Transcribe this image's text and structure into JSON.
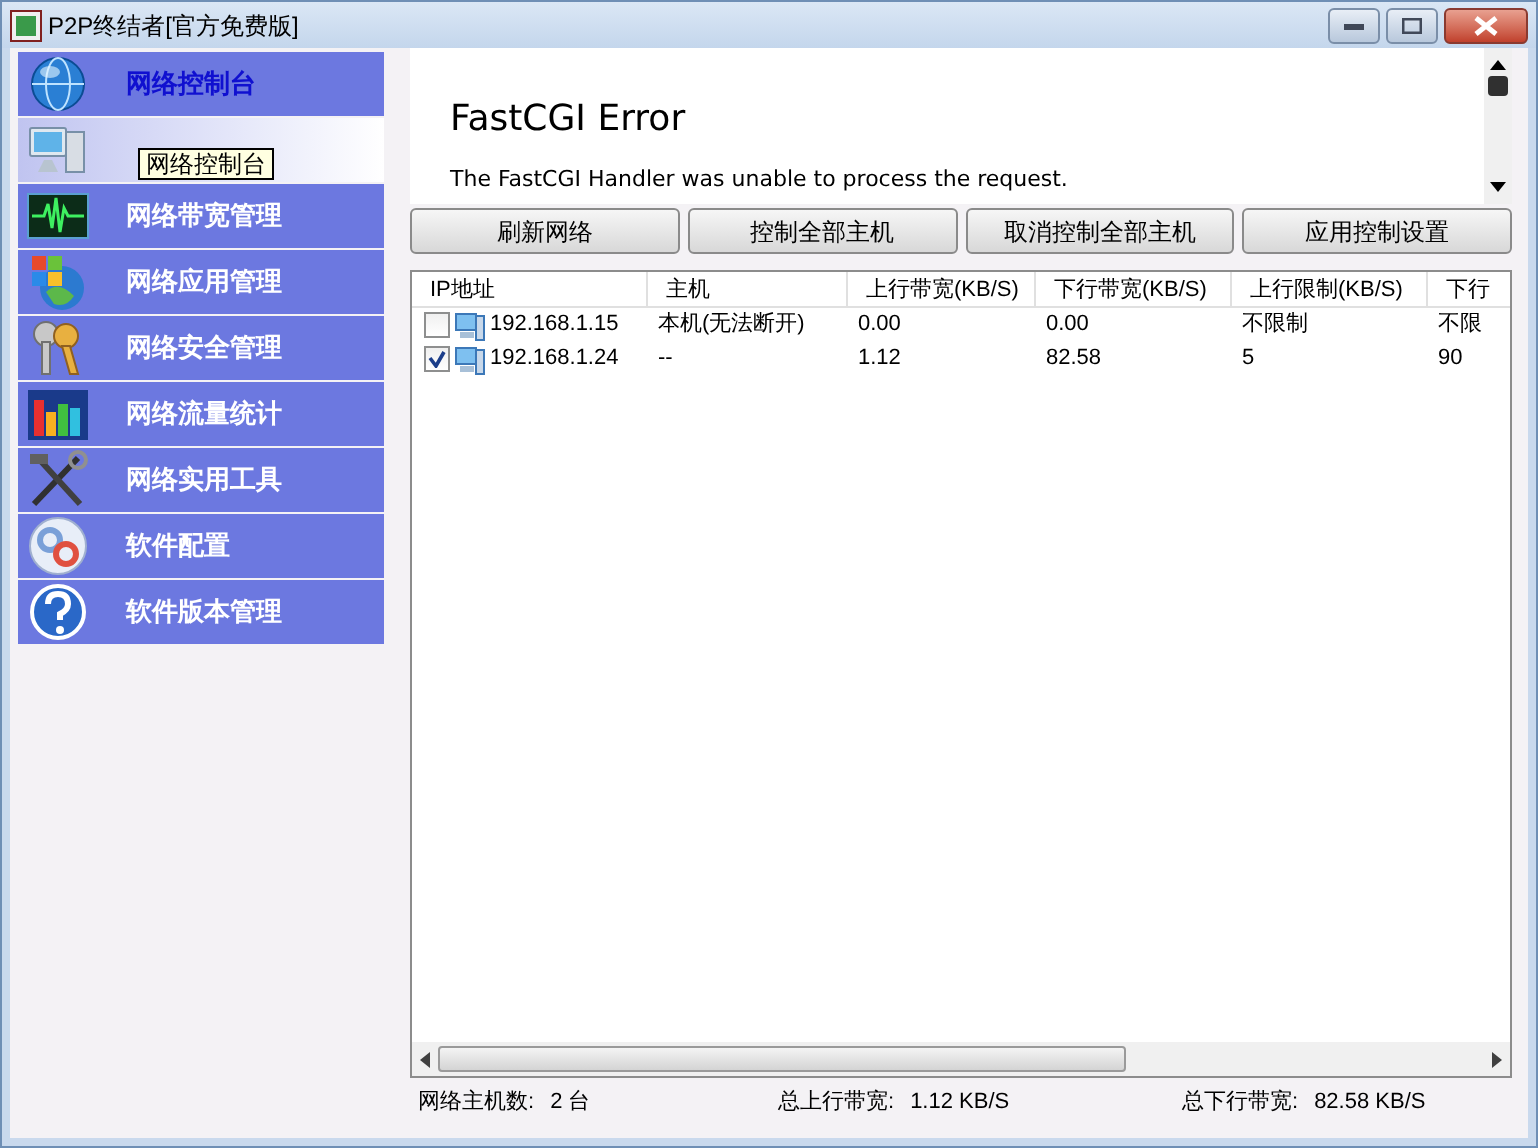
{
  "window": {
    "title": "P2P终结者[官方免费版]"
  },
  "sidebar": {
    "items": [
      {
        "label": "网络控制台",
        "selected": true,
        "hovered": false
      },
      {
        "selected": false,
        "hovered": true
      },
      {
        "label": "网络带宽管理",
        "selected": false,
        "hovered": false
      },
      {
        "label": "网络应用管理",
        "selected": false,
        "hovered": false
      },
      {
        "label": "网络安全管理",
        "selected": false,
        "hovered": false
      },
      {
        "label": "网络流量统计",
        "selected": false,
        "hovered": false
      },
      {
        "label": "网络实用工具",
        "selected": false,
        "hovered": false
      },
      {
        "label": "软件配置",
        "selected": false,
        "hovered": false
      },
      {
        "label": "软件版本管理",
        "selected": false,
        "hovered": false
      }
    ]
  },
  "tooltip": "网络控制台",
  "browser": {
    "heading": "FastCGI Error",
    "message": "The FastCGI Handler was unable to process the request."
  },
  "buttons": [
    "刷新网络",
    "控制全部主机",
    "取消控制全部主机",
    "应用控制设置"
  ],
  "table": {
    "columns": [
      "IP地址",
      "主机",
      "上行带宽(KB/S)",
      "下行带宽(KB/S)",
      "上行限制(KB/S)",
      "下行"
    ],
    "rows": [
      {
        "checked": false,
        "cells": [
          "192.168.1.15",
          "本机(无法断开)",
          "0.00",
          "0.00",
          "不限制",
          "不限"
        ]
      },
      {
        "checked": true,
        "cells": [
          "192.168.1.24",
          "--",
          "1.12",
          "82.58",
          "5",
          "90"
        ]
      }
    ]
  },
  "status_bar": [
    {
      "label": "网络主机数:",
      "value": "2 台"
    },
    {
      "label": "总上行带宽:",
      "value": "1.12 KB/S"
    },
    {
      "label": "总下行带宽:",
      "value": "82.58 KB/S"
    }
  ]
}
